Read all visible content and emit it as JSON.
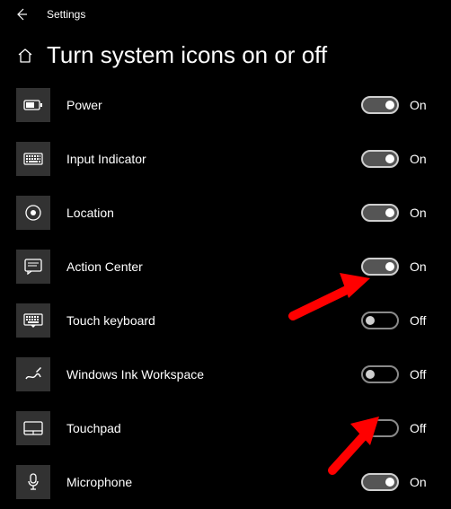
{
  "titlebar": {
    "label": "Settings"
  },
  "header": {
    "title": "Turn system icons on or off"
  },
  "toggle_labels": {
    "on": "On",
    "off": "Off"
  },
  "items": [
    {
      "id": "power",
      "label": "Power",
      "state": "on"
    },
    {
      "id": "input-indicator",
      "label": "Input Indicator",
      "state": "on"
    },
    {
      "id": "location",
      "label": "Location",
      "state": "on"
    },
    {
      "id": "action-center",
      "label": "Action Center",
      "state": "on"
    },
    {
      "id": "touch-keyboard",
      "label": "Touch keyboard",
      "state": "off"
    },
    {
      "id": "windows-ink",
      "label": "Windows Ink Workspace",
      "state": "off"
    },
    {
      "id": "touchpad",
      "label": "Touchpad",
      "state": "off"
    },
    {
      "id": "microphone",
      "label": "Microphone",
      "state": "on"
    }
  ],
  "annotations": {
    "arrow_color": "#ff0000",
    "arrows": [
      {
        "target": "touch-keyboard"
      },
      {
        "target": "touchpad"
      }
    ]
  }
}
